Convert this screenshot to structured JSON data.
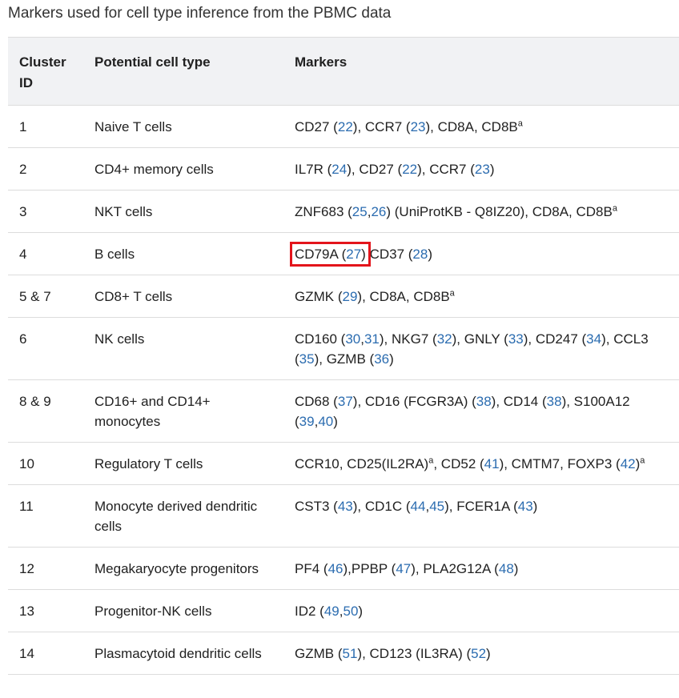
{
  "caption": "Markers used for cell type inference from the PBMC data",
  "headers": {
    "cluster": "Cluster ID",
    "celltype": "Potential cell type",
    "markers": "Markers"
  },
  "highlight_color": "#e3141b",
  "link_color": "#2b6cb0",
  "rows": [
    {
      "id": "1",
      "type": "Naive T cells",
      "markers": [
        {
          "t": "CD27 ("
        },
        {
          "t": "22",
          "ref": true
        },
        {
          "t": "), CCR7 ("
        },
        {
          "t": "23",
          "ref": true
        },
        {
          "t": "), CD8A, CD8B"
        },
        {
          "t": "a",
          "sup": true
        }
      ]
    },
    {
      "id": "2",
      "type": "CD4+ memory cells",
      "markers": [
        {
          "t": "IL7R ("
        },
        {
          "t": "24",
          "ref": true
        },
        {
          "t": "), CD27 ("
        },
        {
          "t": "22",
          "ref": true
        },
        {
          "t": "), CCR7 ("
        },
        {
          "t": "23",
          "ref": true
        },
        {
          "t": ")"
        }
      ]
    },
    {
      "id": "3",
      "type": "NKT cells",
      "markers": [
        {
          "t": "ZNF683 ("
        },
        {
          "t": "25",
          "ref": true
        },
        {
          "t": ","
        },
        {
          "t": "26",
          "ref": true
        },
        {
          "t": ") (UniProtKB - Q8IZ20), CD8A, CD8B"
        },
        {
          "t": "a",
          "sup": true
        }
      ]
    },
    {
      "id": "4",
      "type": "B cells",
      "markers": [
        {
          "t": "CD79A (",
          "hl": "start"
        },
        {
          "t": "27",
          "ref": true,
          "hl": "mid"
        },
        {
          "t": ")",
          "hl": "end"
        },
        {
          "t": " CD37 ("
        },
        {
          "t": "28",
          "ref": true
        },
        {
          "t": ")"
        }
      ]
    },
    {
      "id": "5 & 7",
      "type": "CD8+ T cells",
      "markers": [
        {
          "t": "GZMK ("
        },
        {
          "t": "29",
          "ref": true
        },
        {
          "t": "), CD8A, CD8B"
        },
        {
          "t": "a",
          "sup": true
        }
      ]
    },
    {
      "id": "6",
      "type": "NK cells",
      "markers": [
        {
          "t": "CD160 ("
        },
        {
          "t": "30",
          "ref": true
        },
        {
          "t": ","
        },
        {
          "t": "31",
          "ref": true
        },
        {
          "t": "), NKG7 ("
        },
        {
          "t": "32",
          "ref": true
        },
        {
          "t": "), GNLY ("
        },
        {
          "t": "33",
          "ref": true
        },
        {
          "t": "), CD247 ("
        },
        {
          "t": "34",
          "ref": true
        },
        {
          "t": "), CCL3 ("
        },
        {
          "t": "35",
          "ref": true
        },
        {
          "t": "), GZMB ("
        },
        {
          "t": "36",
          "ref": true
        },
        {
          "t": ")"
        }
      ]
    },
    {
      "id": "8 & 9",
      "type": "CD16+ and CD14+ monocytes",
      "markers": [
        {
          "t": "CD68 ("
        },
        {
          "t": "37",
          "ref": true
        },
        {
          "t": "), CD16 (FCGR3A) ("
        },
        {
          "t": "38",
          "ref": true
        },
        {
          "t": "), CD14 ("
        },
        {
          "t": "38",
          "ref": true
        },
        {
          "t": "), S100A12 ("
        },
        {
          "t": "39",
          "ref": true
        },
        {
          "t": ","
        },
        {
          "t": "40",
          "ref": true
        },
        {
          "t": ")"
        }
      ]
    },
    {
      "id": "10",
      "type": "Regulatory T cells",
      "markers": [
        {
          "t": "CCR10, CD25(IL2RA)"
        },
        {
          "t": "a",
          "sup": true
        },
        {
          "t": ", CD52 ("
        },
        {
          "t": "41",
          "ref": true
        },
        {
          "t": "), CMTM7, FOXP3 ("
        },
        {
          "t": "42",
          "ref": true
        },
        {
          "t": ")"
        },
        {
          "t": "a",
          "sup": true
        }
      ]
    },
    {
      "id": "11",
      "type": "Monocyte derived dendritic cells",
      "markers": [
        {
          "t": "CST3 ("
        },
        {
          "t": "43",
          "ref": true
        },
        {
          "t": "), CD1C ("
        },
        {
          "t": "44",
          "ref": true
        },
        {
          "t": ","
        },
        {
          "t": "45",
          "ref": true
        },
        {
          "t": "), FCER1A ("
        },
        {
          "t": "43",
          "ref": true
        },
        {
          "t": ")"
        }
      ]
    },
    {
      "id": "12",
      "type": "Megakaryocyte progenitors",
      "markers": [
        {
          "t": "PF4 ("
        },
        {
          "t": "46",
          "ref": true
        },
        {
          "t": "),PPBP ("
        },
        {
          "t": "47",
          "ref": true
        },
        {
          "t": "), PLA2G12A ("
        },
        {
          "t": "48",
          "ref": true
        },
        {
          "t": ")"
        }
      ]
    },
    {
      "id": "13",
      "type": "Progenitor-NK cells",
      "markers": [
        {
          "t": "ID2 ("
        },
        {
          "t": "49",
          "ref": true
        },
        {
          "t": ","
        },
        {
          "t": "50",
          "ref": true
        },
        {
          "t": ")"
        }
      ]
    },
    {
      "id": "14",
      "type": "Plasmacytoid dendritic cells",
      "markers": [
        {
          "t": "GZMB ("
        },
        {
          "t": "51",
          "ref": true
        },
        {
          "t": "), CD123 (IL3RA) ("
        },
        {
          "t": "52",
          "ref": true
        },
        {
          "t": ")"
        }
      ]
    }
  ]
}
